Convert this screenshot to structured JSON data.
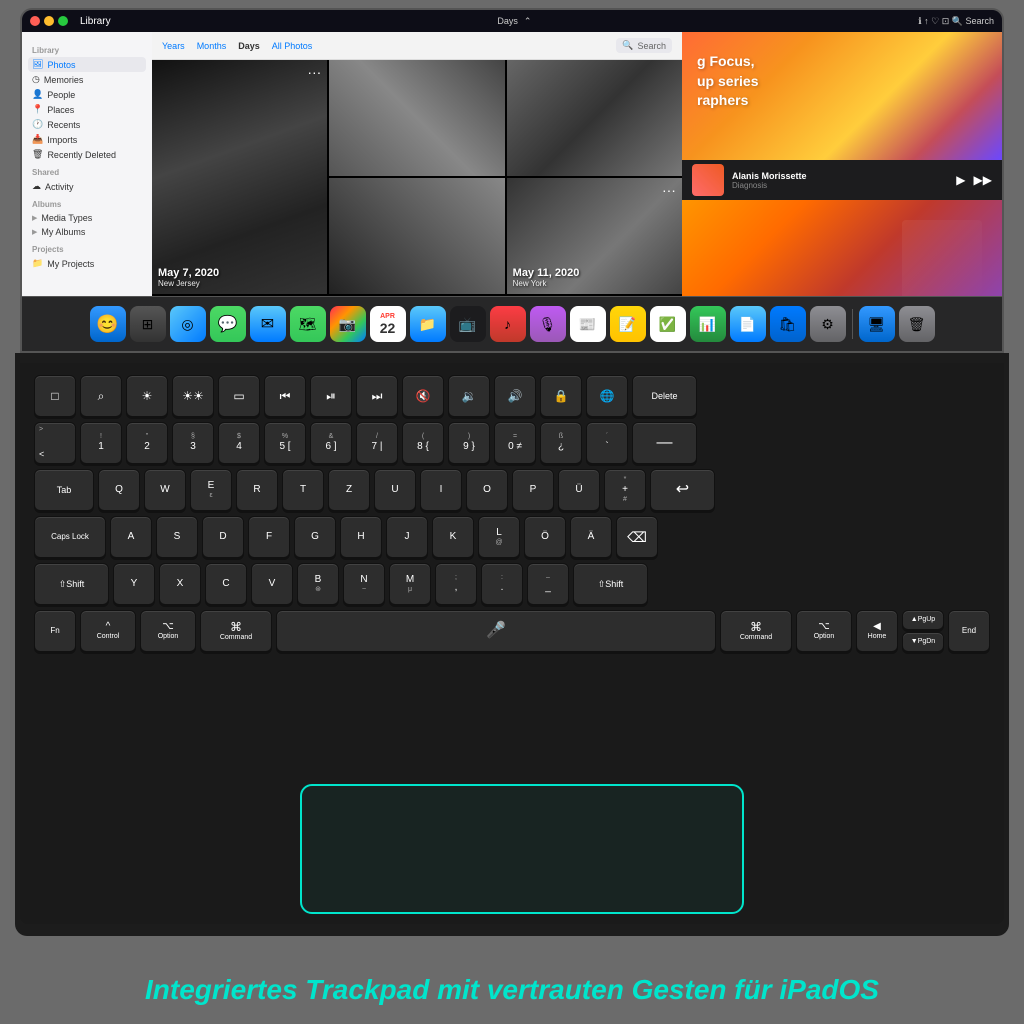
{
  "ipad": {
    "screen": {
      "title": "Photos"
    },
    "sidebar": {
      "library_label": "Library",
      "items": [
        {
          "label": "Photos",
          "active": true,
          "icon": "🖼"
        },
        {
          "label": "Memories",
          "active": false,
          "icon": "◷"
        },
        {
          "label": "People",
          "active": false,
          "icon": "👤"
        },
        {
          "label": "Places",
          "active": false,
          "icon": "📍"
        },
        {
          "label": "Recents",
          "active": false,
          "icon": "🕐"
        },
        {
          "label": "Imports",
          "active": false,
          "icon": "📥"
        },
        {
          "label": "Recently Deleted",
          "active": false,
          "icon": "🗑"
        }
      ],
      "shared_label": "Shared",
      "shared_items": [
        {
          "label": "Activity",
          "icon": "☁"
        }
      ],
      "albums_label": "Albums",
      "album_items": [
        {
          "label": "Media Types",
          "icon": "▶"
        },
        {
          "label": "My Albums",
          "icon": "▶"
        }
      ],
      "projects_label": "Projects",
      "project_items": [
        {
          "label": "My Projects",
          "icon": "📁"
        }
      ]
    },
    "photo1_date": "May 7, 2020",
    "photo1_loc": "New Jersey",
    "photo2_date": "May 11, 2020",
    "photo2_loc": "New York",
    "magazine_text_line1": "g Focus,",
    "magazine_text_line2": "up series",
    "magazine_text_line3": "raphers",
    "music_title": "Alanis Morissette",
    "music_artist": "Diagnosis"
  },
  "keyboard": {
    "row1": {
      "keys": [
        "□",
        "⌕",
        "☀",
        "☀☀",
        "▭",
        "⏮",
        "⏯",
        "⏭",
        "🔇",
        "🔉",
        "🔊",
        "🔒",
        "🌐",
        "Delete"
      ]
    },
    "row2": {
      "keys": [
        "> <",
        "! 1",
        "\" 2",
        "§ 3",
        "$ 4",
        "% 5[",
        "& 6]",
        "/ 7|",
        "( 8{",
        ") 9}",
        "= 0≠",
        "ß ¿",
        "´ `",
        "—"
      ]
    },
    "row3_tab": "Tab",
    "row3_keys": [
      "Q",
      "W",
      "Eε",
      "R",
      "T",
      "Z",
      "U",
      "I",
      "O",
      "P",
      "Ü",
      "* + #"
    ],
    "row4_caps": "Caps Lock",
    "row4_keys": [
      "A",
      "S",
      "D",
      "F",
      "G",
      "H",
      "J",
      "K",
      "L@",
      "Ö",
      "Ä",
      "⌫"
    ],
    "row5_shift_l": "⇧Shift",
    "row5_keys": [
      "Y",
      "X",
      "C",
      "V",
      "B⊛",
      "N~",
      "Mμ",
      "; ,",
      ": .",
      "– _",
      "⇧Shift"
    ],
    "row6": {
      "fn": "Fn",
      "control": "Control",
      "option_l": "Option",
      "command_l": "Command",
      "space_icon": "🎤",
      "command_r": "Command",
      "option_r": "Option",
      "home": "Home",
      "pgup": "▲PgUp",
      "pgdn": "▼PgDn",
      "end": "End"
    }
  },
  "trackpad": {
    "visible": true
  },
  "bottom_text": "Integriertes Trackpad mit vertrauten Gesten für iPadOS"
}
